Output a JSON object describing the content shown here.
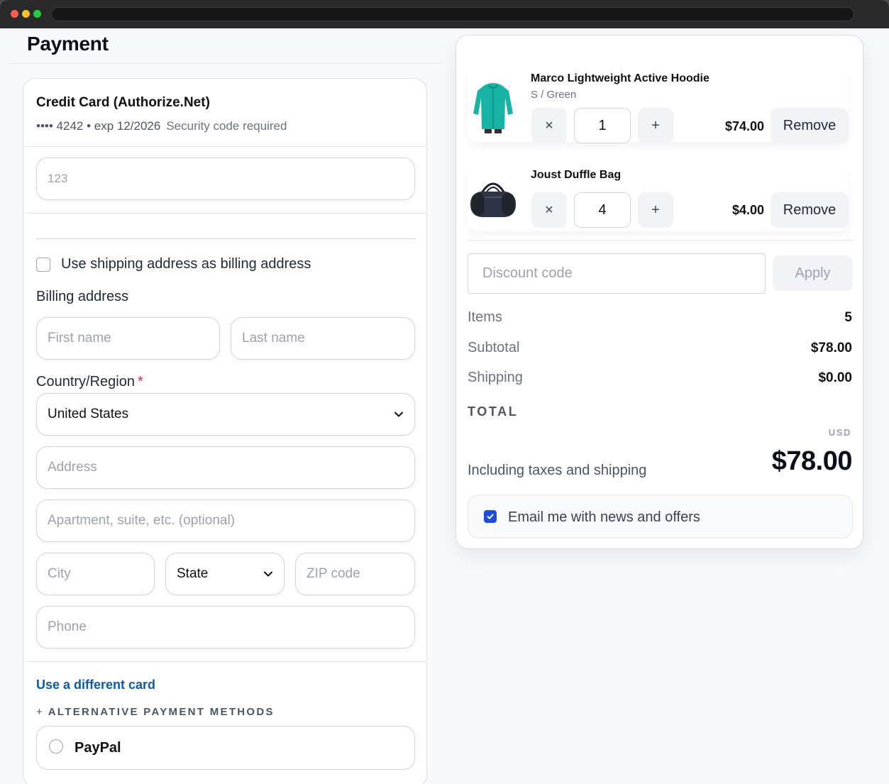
{
  "page": {
    "title": "Payment"
  },
  "payment": {
    "method_title": "Credit Card (Authorize.Net)",
    "card_summary": "•••• 4242 • exp 12/2026",
    "security_note": "Security code required",
    "cvv_placeholder": "123",
    "same_address_label": "Use shipping address as billing address",
    "same_address_checked": false,
    "billing_label": "Billing address",
    "first_name_placeholder": "First name",
    "last_name_placeholder": "Last name",
    "country_label": "Country/Region",
    "required_mark": "*",
    "country_value": "United States",
    "address_placeholder": "Address",
    "apartment_placeholder": "Apartment, suite, etc. (optional)",
    "city_placeholder": "City",
    "state_value": "State",
    "zip_placeholder": "ZIP code",
    "phone_placeholder": "Phone",
    "different_card_link": "Use a different card",
    "alt_methods_plus": "+",
    "alt_methods_label": "ALTERNATIVE PAYMENT METHODS",
    "paypal_label": "PayPal"
  },
  "cart": {
    "items": [
      {
        "name": "Marco Lightweight Active Hoodie",
        "variant": "S / Green",
        "qty": "1",
        "price": "$74.00",
        "remove_label": "Remove",
        "minus_label": "×",
        "plus_label": "+"
      },
      {
        "name": "Joust Duffle Bag",
        "variant": "",
        "qty": "4",
        "price": "$4.00",
        "remove_label": "Remove",
        "minus_label": "×",
        "plus_label": "+"
      }
    ],
    "discount_placeholder": "Discount code",
    "apply_label": "Apply",
    "items_label": "Items",
    "items_value": "5",
    "subtotal_label": "Subtotal",
    "subtotal_value": "$78.00",
    "shipping_label": "Shipping",
    "shipping_value": "$0.00",
    "total_label": "TOTAL",
    "currency": "USD",
    "including_label": "Including taxes and shipping",
    "total_value": "$78.00",
    "email_optin_label": "Email me with news and offers",
    "email_optin_checked": true
  },
  "colors": {
    "accent": "#1d4ed8",
    "link": "#0e5aa7",
    "required": "#e11d48"
  },
  "icons": [
    "chevron-down-icon",
    "check-icon",
    "hoodie-icon",
    "duffle-bag-icon"
  ]
}
